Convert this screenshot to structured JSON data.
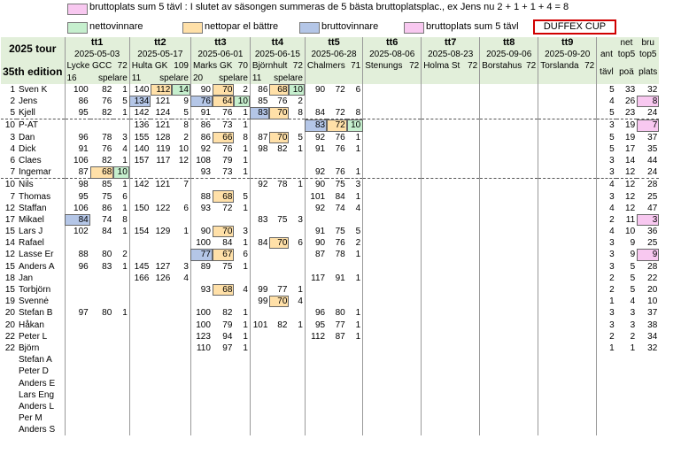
{
  "legend1": {
    "text": "bruttoplats sum 5 tävl :  I slutet av säsongen summeras de 5 bästa bruttoplatsplac., ex Jens nu   2 + 1 + 1 + 4 = 8",
    "color": "#f8c8f0"
  },
  "legend2": [
    {
      "text": "nettovinnare",
      "color": "#c6efce"
    },
    {
      "text": "nettopar el bättre",
      "color": "#ffe0a8"
    },
    {
      "text": "bruttovinnare",
      "color": "#b4c6e7"
    },
    {
      "text": "bruttoplats sum 5 tävl",
      "color": "#f8c8f0"
    }
  ],
  "cup_label": "DUFFEX CUP",
  "tour": {
    "line1": "2025 tour",
    "line2": "35th edition"
  },
  "events": [
    {
      "code": "tt1",
      "date": "2025-05-03",
      "course": "Lycke GCC",
      "par": "72",
      "players": "16",
      "players_label": "spelare"
    },
    {
      "code": "tt2",
      "date": "2025-05-17",
      "course": "Hulta GK",
      "par": "109",
      "players": "11",
      "players_label": "spelare"
    },
    {
      "code": "tt3",
      "date": "2025-06-01",
      "course": "Marks GK",
      "par": "70",
      "players": "20",
      "players_label": "spelare"
    },
    {
      "code": "tt4",
      "date": "2025-06-15",
      "course": "Björnhult",
      "par": "72",
      "players": "11",
      "players_label": "spelare"
    },
    {
      "code": "tt5",
      "date": "2025-06-28",
      "course": "Chalmers",
      "par": "71",
      "players": "",
      "players_label": ""
    },
    {
      "code": "tt6",
      "date": "2025-08-06",
      "course": "Stenungs",
      "par": "72",
      "players": "",
      "players_label": ""
    },
    {
      "code": "tt7",
      "date": "2025-08-23",
      "course": "Holma St",
      "par": "72",
      "players": "",
      "players_label": ""
    },
    {
      "code": "tt8",
      "date": "2025-09-06",
      "course": "Borstahus",
      "par": "72",
      "players": "",
      "players_label": ""
    },
    {
      "code": "tt9",
      "date": "2025-09-20",
      "course": "Torslanda",
      "par": "72",
      "players": "",
      "players_label": ""
    }
  ],
  "summary_headers": {
    "a1": "",
    "a2": "ant",
    "a3": "tävl",
    "b1": "net",
    "b2": "top5",
    "b3": "poä",
    "c1": "bru",
    "c2": "top5",
    "c3": "plats"
  },
  "players": [
    {
      "rank": "1",
      "name": "Sven K",
      "ev": [
        [
          "100",
          "82",
          "1",
          ""
        ],
        [
          "140",
          "112",
          "14",
          "yg"
        ],
        [
          "90",
          "70",
          "2",
          "y"
        ],
        [
          "86",
          "68",
          "10",
          "yg"
        ],
        [
          "90",
          "72",
          "6",
          ""
        ]
      ],
      "ant": "5",
      "net": "33",
      "bru": "32",
      "bc": ""
    },
    {
      "rank": "2",
      "name": "Jens",
      "ev": [
        [
          "86",
          "76",
          "5",
          ""
        ],
        [
          "134",
          "121",
          "9",
          "b"
        ],
        [
          "76",
          "64",
          "10",
          "byg"
        ],
        [
          "85",
          "76",
          "2",
          ""
        ],
        [
          "",
          "",
          "",
          ""
        ]
      ],
      "ant": "4",
      "net": "26",
      "bru": "8",
      "bc": "p"
    },
    {
      "rank": "5",
      "name": "Kjell",
      "ev": [
        [
          "95",
          "82",
          "1",
          ""
        ],
        [
          "142",
          "124",
          "5",
          ""
        ],
        [
          "91",
          "76",
          "1",
          ""
        ],
        [
          "83",
          "70",
          "8",
          "by"
        ],
        [
          "84",
          "72",
          "8",
          ""
        ]
      ],
      "ant": "5",
      "net": "23",
      "bru": "24",
      "bc": ""
    },
    {
      "rank": "10",
      "name": "P-AT",
      "ev": [
        [
          "",
          "",
          "",
          ""
        ],
        [
          "136",
          "121",
          "8",
          ""
        ],
        [
          "86",
          "73",
          "1",
          ""
        ],
        [
          "",
          "",
          "",
          ""
        ],
        [
          "83",
          "72",
          "10",
          "byg"
        ]
      ],
      "ant": "3",
      "net": "19",
      "bru": "7",
      "bc": "p",
      "dash": true
    },
    {
      "rank": "3",
      "name": "Dan",
      "ev": [
        [
          "96",
          "78",
          "3",
          ""
        ],
        [
          "155",
          "128",
          "2",
          ""
        ],
        [
          "86",
          "66",
          "8",
          "y"
        ],
        [
          "87",
          "70",
          "5",
          "y"
        ],
        [
          "92",
          "76",
          "1",
          ""
        ]
      ],
      "ant": "5",
      "net": "19",
      "bru": "37",
      "bc": ""
    },
    {
      "rank": "4",
      "name": "Dick",
      "ev": [
        [
          "91",
          "76",
          "4",
          ""
        ],
        [
          "140",
          "119",
          "10",
          ""
        ],
        [
          "92",
          "76",
          "1",
          ""
        ],
        [
          "98",
          "82",
          "1",
          ""
        ],
        [
          "91",
          "76",
          "1",
          ""
        ]
      ],
      "ant": "5",
      "net": "17",
      "bru": "35",
      "bc": ""
    },
    {
      "rank": "6",
      "name": "Claes",
      "ev": [
        [
          "106",
          "82",
          "1",
          ""
        ],
        [
          "157",
          "117",
          "12",
          ""
        ],
        [
          "108",
          "79",
          "1",
          ""
        ],
        [
          "",
          "",
          "",
          ""
        ],
        [
          "",
          "",
          "",
          ""
        ]
      ],
      "ant": "3",
      "net": "14",
      "bru": "44",
      "bc": ""
    },
    {
      "rank": "7",
      "name": "Ingemar",
      "ev": [
        [
          "87",
          "68",
          "10",
          "yg"
        ],
        [
          "",
          "",
          "",
          ""
        ],
        [
          "93",
          "73",
          "1",
          ""
        ],
        [
          "",
          "",
          "",
          ""
        ],
        [
          "92",
          "76",
          "1",
          ""
        ]
      ],
      "ant": "3",
      "net": "12",
      "bru": "24",
      "bc": ""
    },
    {
      "rank": "10",
      "name": "Nils",
      "ev": [
        [
          "98",
          "85",
          "1",
          ""
        ],
        [
          "142",
          "121",
          "7",
          ""
        ],
        [
          "",
          "",
          "",
          ""
        ],
        [
          "92",
          "78",
          "1",
          ""
        ],
        [
          "90",
          "75",
          "3",
          ""
        ]
      ],
      "ant": "4",
      "net": "12",
      "bru": "28",
      "bc": "",
      "dash": true
    },
    {
      "rank": "7",
      "name": "Thomas",
      "ev": [
        [
          "95",
          "75",
          "6",
          ""
        ],
        [
          "",
          "",
          "",
          ""
        ],
        [
          "88",
          "68",
          "5",
          "y"
        ],
        [
          "",
          "",
          "",
          ""
        ],
        [
          "101",
          "84",
          "1",
          ""
        ]
      ],
      "ant": "3",
      "net": "12",
      "bru": "25",
      "bc": ""
    },
    {
      "rank": "12",
      "name": "Staffan",
      "ev": [
        [
          "106",
          "86",
          "1",
          ""
        ],
        [
          "150",
          "122",
          "6",
          ""
        ],
        [
          "93",
          "72",
          "1",
          ""
        ],
        [
          "",
          "",
          "",
          ""
        ],
        [
          "92",
          "74",
          "4",
          ""
        ]
      ],
      "ant": "4",
      "net": "12",
      "bru": "47",
      "bc": ""
    },
    {
      "rank": "17",
      "name": "Mikael",
      "ev": [
        [
          "84",
          "74",
          "8",
          "b"
        ],
        [
          "",
          "",
          "",
          ""
        ],
        [
          "",
          "",
          "",
          ""
        ],
        [
          "83",
          "75",
          "3",
          ""
        ],
        [
          "",
          "",
          "",
          ""
        ]
      ],
      "ant": "2",
      "net": "11",
      "bru": "3",
      "bc": "p"
    },
    {
      "rank": "15",
      "name": "Lars J",
      "ev": [
        [
          "102",
          "84",
          "1",
          ""
        ],
        [
          "154",
          "129",
          "1",
          ""
        ],
        [
          "90",
          "70",
          "3",
          "y"
        ],
        [
          "",
          "",
          "",
          ""
        ],
        [
          "91",
          "75",
          "5",
          ""
        ]
      ],
      "ant": "4",
      "net": "10",
      "bru": "36",
      "bc": ""
    },
    {
      "rank": "14",
      "name": "Rafael",
      "ev": [
        [
          "",
          "",
          "",
          ""
        ],
        [
          "",
          "",
          "",
          ""
        ],
        [
          "100",
          "84",
          "1",
          ""
        ],
        [
          "84",
          "70",
          "6",
          "y"
        ],
        [
          "90",
          "76",
          "2",
          ""
        ]
      ],
      "ant": "3",
      "net": "9",
      "bru": "25",
      "bc": ""
    },
    {
      "rank": "12",
      "name": "Lasse Er",
      "ev": [
        [
          "88",
          "80",
          "2",
          ""
        ],
        [
          "",
          "",
          "",
          ""
        ],
        [
          "77",
          "67",
          "6",
          "by"
        ],
        [
          "",
          "",
          "",
          ""
        ],
        [
          "87",
          "78",
          "1",
          ""
        ]
      ],
      "ant": "3",
      "net": "9",
      "bru": "9",
      "bc": "p"
    },
    {
      "rank": "15",
      "name": "Anders A",
      "ev": [
        [
          "96",
          "83",
          "1",
          ""
        ],
        [
          "145",
          "127",
          "3",
          ""
        ],
        [
          "89",
          "75",
          "1",
          ""
        ],
        [
          "",
          "",
          "",
          ""
        ],
        [
          "",
          "",
          "",
          ""
        ]
      ],
      "ant": "3",
      "net": "5",
      "bru": "28",
      "bc": ""
    },
    {
      "rank": "18",
      "name": "Jan",
      "ev": [
        [
          "",
          "",
          "",
          ""
        ],
        [
          "166",
          "126",
          "4",
          ""
        ],
        [
          "",
          "",
          "",
          ""
        ],
        [
          "",
          "",
          "",
          ""
        ],
        [
          "117",
          "91",
          "1",
          ""
        ]
      ],
      "ant": "2",
      "net": "5",
      "bru": "22",
      "bc": ""
    },
    {
      "rank": "15",
      "name": "Torbjörn",
      "ev": [
        [
          "",
          "",
          "",
          ""
        ],
        [
          "",
          "",
          "",
          ""
        ],
        [
          "93",
          "68",
          "4",
          "y"
        ],
        [
          "99",
          "77",
          "1",
          ""
        ],
        [
          "",
          "",
          "",
          ""
        ]
      ],
      "ant": "2",
      "net": "5",
      "bru": "20",
      "bc": ""
    },
    {
      "rank": "19",
      "name": "Svennė",
      "ev": [
        [
          "",
          "",
          "",
          ""
        ],
        [
          "",
          "",
          "",
          ""
        ],
        [
          "",
          "",
          "",
          ""
        ],
        [
          "99",
          "70",
          "4",
          "y"
        ],
        [
          "",
          "",
          "",
          ""
        ]
      ],
      "ant": "1",
      "net": "4",
      "bru": "10",
      "bc": ""
    },
    {
      "rank": "20",
      "name": "Stefan B",
      "ev": [
        [
          "97",
          "80",
          "1",
          ""
        ],
        [
          "",
          "",
          "",
          ""
        ],
        [
          "100",
          "82",
          "1",
          ""
        ],
        [
          "",
          "",
          "",
          ""
        ],
        [
          "96",
          "80",
          "1",
          ""
        ]
      ],
      "ant": "3",
      "net": "3",
      "bru": "37",
      "bc": ""
    },
    {
      "rank": "20",
      "name": "Håkan",
      "ev": [
        [
          "",
          "",
          "",
          ""
        ],
        [
          "",
          "",
          "",
          ""
        ],
        [
          "100",
          "79",
          "1",
          ""
        ],
        [
          "101",
          "82",
          "1",
          ""
        ],
        [
          "95",
          "77",
          "1",
          ""
        ]
      ],
      "ant": "3",
      "net": "3",
      "bru": "38",
      "bc": ""
    },
    {
      "rank": "22",
      "name": "Peter L",
      "ev": [
        [
          "",
          "",
          "",
          ""
        ],
        [
          "",
          "",
          "",
          ""
        ],
        [
          "123",
          "94",
          "1",
          ""
        ],
        [
          "",
          "",
          "",
          ""
        ],
        [
          "112",
          "87",
          "1",
          ""
        ]
      ],
      "ant": "2",
      "net": "2",
      "bru": "34",
      "bc": ""
    },
    {
      "rank": "22",
      "name": "Björn",
      "ev": [
        [
          "",
          "",
          "",
          ""
        ],
        [
          "",
          "",
          "",
          ""
        ],
        [
          "110",
          "97",
          "1",
          ""
        ],
        [
          "",
          "",
          "",
          ""
        ],
        [
          "",
          "",
          "",
          ""
        ]
      ],
      "ant": "1",
      "net": "1",
      "bru": "32",
      "bc": ""
    },
    {
      "rank": "",
      "name": "Stefan A",
      "ev": [],
      "ant": "",
      "net": "",
      "bru": "",
      "bc": ""
    },
    {
      "rank": "",
      "name": "Peter D",
      "ev": [],
      "ant": "",
      "net": "",
      "bru": "",
      "bc": ""
    },
    {
      "rank": "",
      "name": "Anders E",
      "ev": [],
      "ant": "",
      "net": "",
      "bru": "",
      "bc": ""
    },
    {
      "rank": "",
      "name": "Lars Eng",
      "ev": [],
      "ant": "",
      "net": "",
      "bru": "",
      "bc": ""
    },
    {
      "rank": "",
      "name": "Anders L",
      "ev": [],
      "ant": "",
      "net": "",
      "bru": "",
      "bc": ""
    },
    {
      "rank": "",
      "name": "Per M",
      "ev": [],
      "ant": "",
      "net": "",
      "bru": "",
      "bc": ""
    },
    {
      "rank": "",
      "name": "Anders S",
      "ev": [],
      "ant": "",
      "net": "",
      "bru": "",
      "bc": ""
    }
  ]
}
